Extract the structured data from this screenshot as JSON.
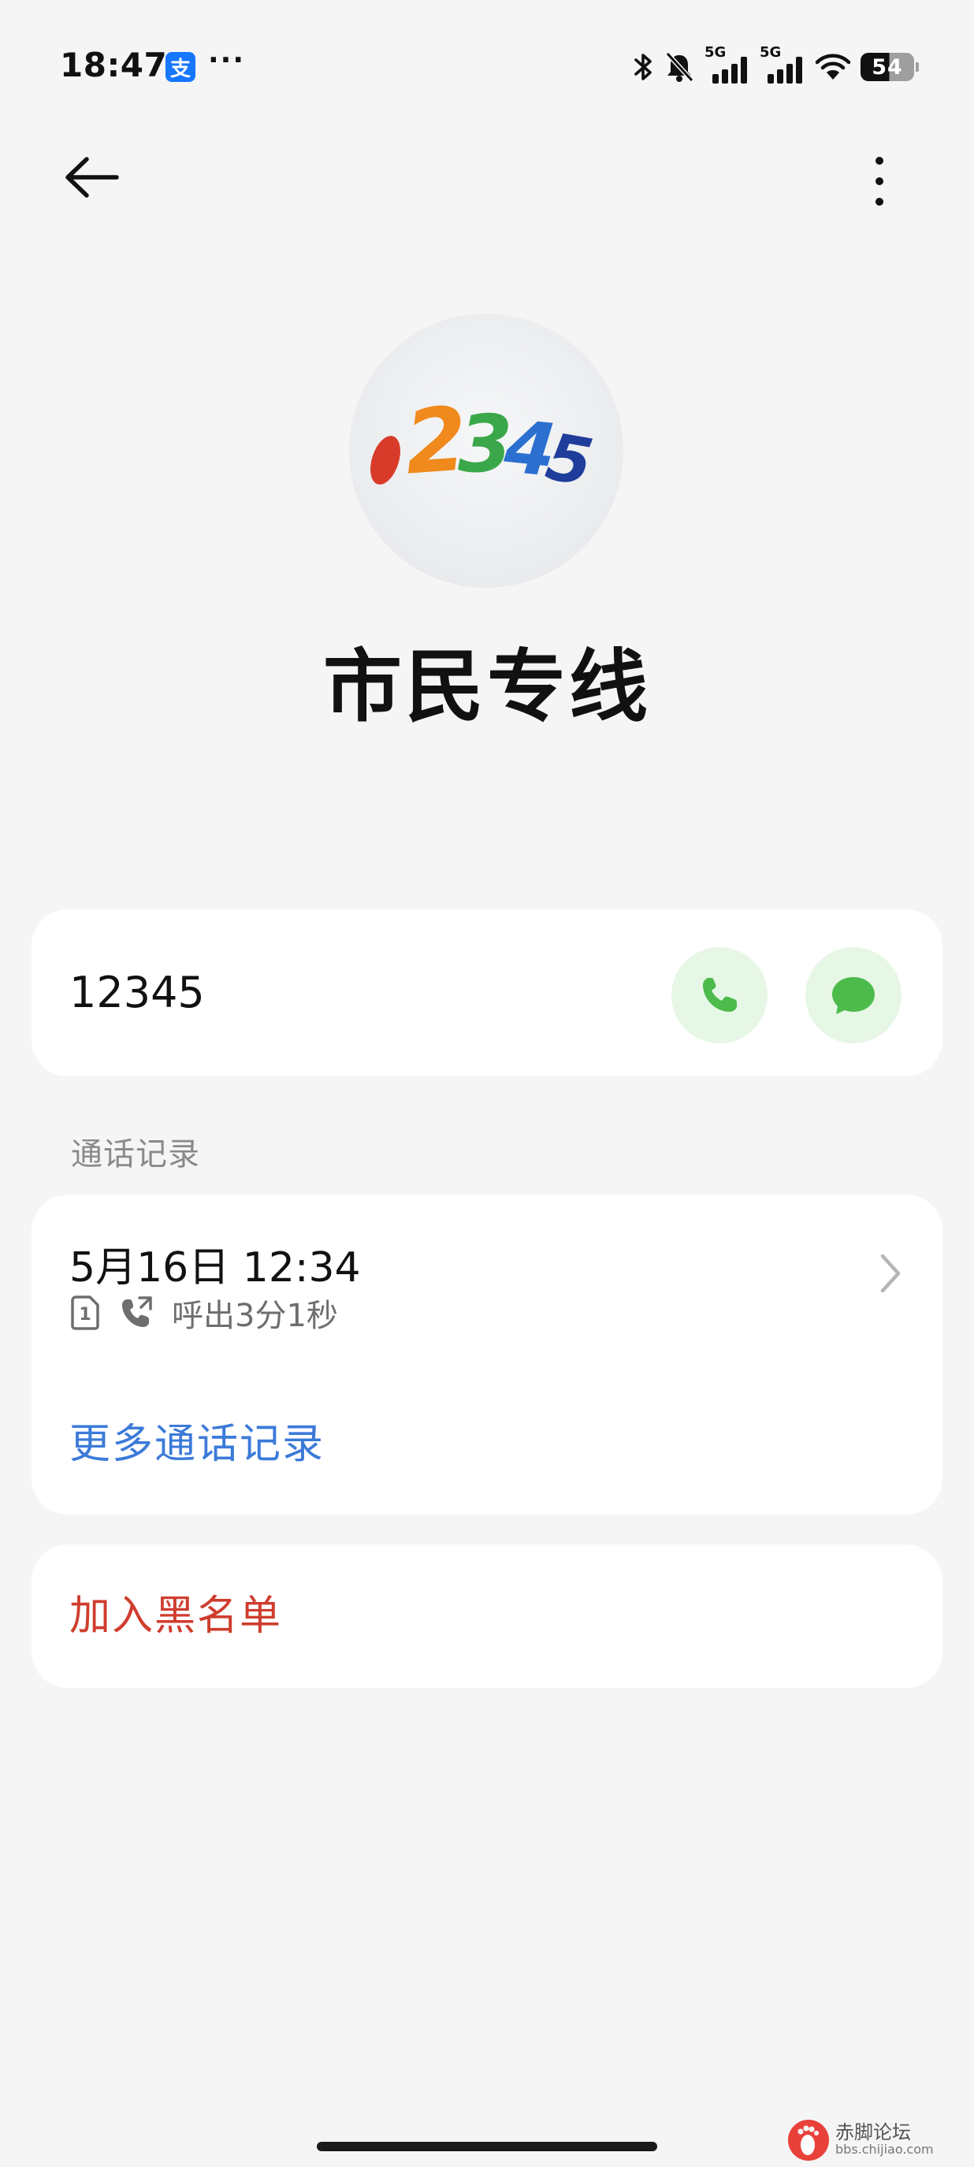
{
  "status_bar": {
    "time": "18:47",
    "app_icon": "支",
    "more_notifications": "···",
    "network_1": "5G",
    "network_2": "5G",
    "battery_level": "54"
  },
  "avatar": {
    "logo_digits": [
      "1",
      "2",
      "3",
      "4",
      "5"
    ],
    "logo_colors": [
      "#d93b2b",
      "#f08a1c",
      "#3aa84a",
      "#2b6fd0",
      "#1f3d9a"
    ]
  },
  "contact": {
    "name": "市民专线",
    "number": "12345"
  },
  "call_history": {
    "section_label": "通话记录",
    "entry": {
      "datetime": "5月16日 12:34",
      "sim": "1",
      "detail": "呼出3分1秒"
    },
    "more_label": "更多通话记录"
  },
  "block": {
    "label": "加入黑名单"
  },
  "watermark": {
    "title": "赤脚论坛",
    "url": "bbs.chijiao.com"
  },
  "colors": {
    "accent_blue": "#3b7ad9",
    "danger_red": "#cf3d2e",
    "action_green": "#4cbb4c",
    "action_bg": "#e6f7e6"
  }
}
